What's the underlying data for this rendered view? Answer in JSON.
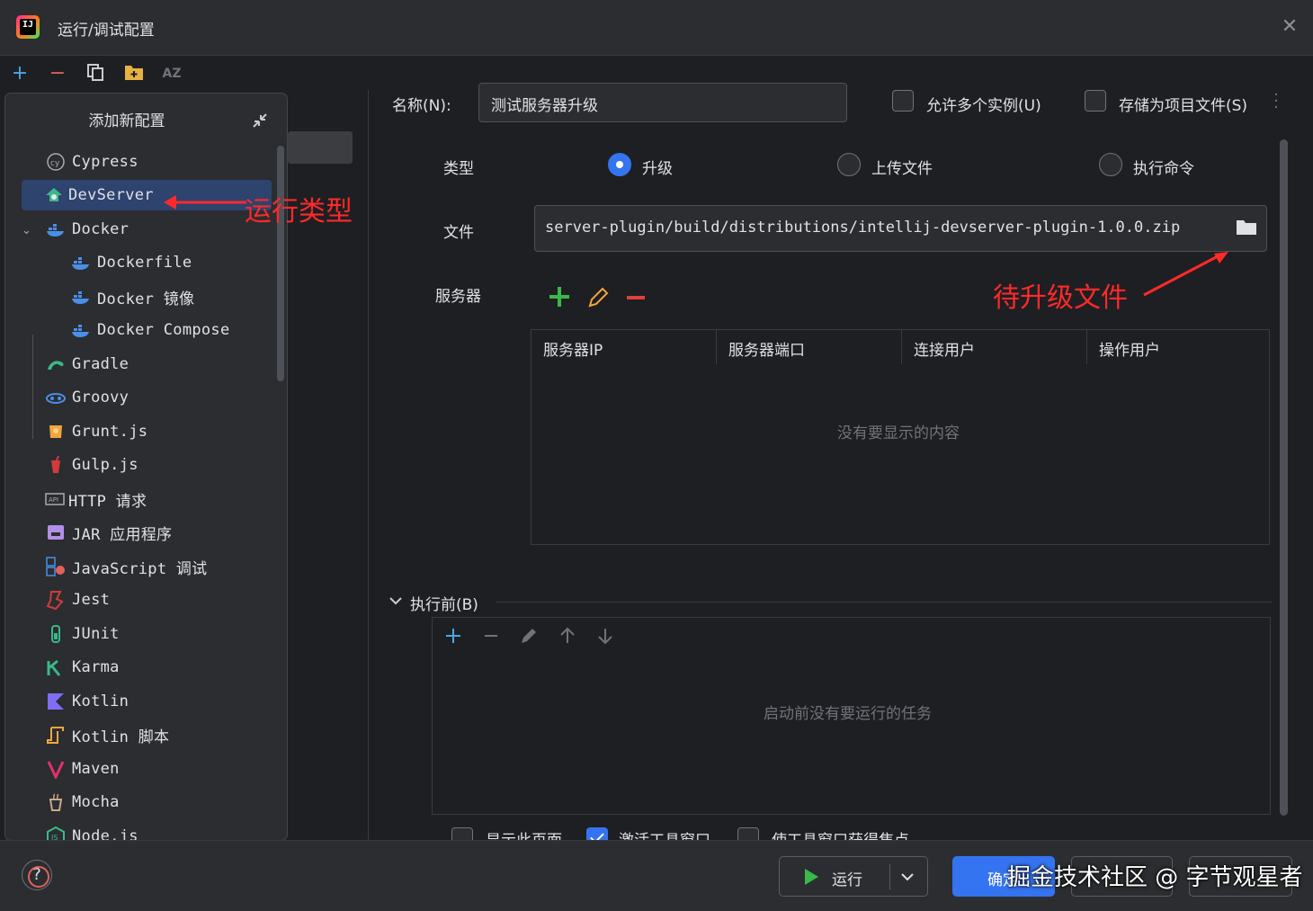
{
  "window": {
    "title": "运行/调试配置"
  },
  "toolbar": {
    "icons": [
      "add-icon",
      "remove-icon",
      "copy-icon",
      "new-folder-icon",
      "sort-az-icon"
    ],
    "sort_label": "AZ"
  },
  "popup": {
    "title": "添加新配置",
    "items": [
      {
        "label": "Cypress",
        "icon": "cypress-icon"
      },
      {
        "label": "DevServer",
        "icon": "devserver-icon",
        "selected": true
      },
      {
        "label": "Docker",
        "icon": "docker-icon",
        "expanded": true
      },
      {
        "label": "Dockerfile",
        "icon": "docker-icon",
        "child": true
      },
      {
        "label": "Docker 镜像",
        "icon": "docker-icon",
        "child": true
      },
      {
        "label": "Docker Compose",
        "icon": "docker-icon",
        "child": true
      },
      {
        "label": "Gradle",
        "icon": "gradle-icon"
      },
      {
        "label": "Groovy",
        "icon": "groovy-icon"
      },
      {
        "label": "Grunt.js",
        "icon": "grunt-icon"
      },
      {
        "label": "Gulp.js",
        "icon": "gulp-icon"
      },
      {
        "label": "HTTP 请求",
        "icon": "http-api-icon"
      },
      {
        "label": "JAR 应用程序",
        "icon": "jar-icon"
      },
      {
        "label": "JavaScript 调试",
        "icon": "js-debug-icon"
      },
      {
        "label": "Jest",
        "icon": "jest-icon"
      },
      {
        "label": "JUnit",
        "icon": "junit-icon"
      },
      {
        "label": "Karma",
        "icon": "karma-icon"
      },
      {
        "label": "Kotlin",
        "icon": "kotlin-icon"
      },
      {
        "label": "Kotlin 脚本",
        "icon": "kotlin-script-icon"
      },
      {
        "label": "Maven",
        "icon": "maven-icon"
      },
      {
        "label": "Mocha",
        "icon": "mocha-icon"
      },
      {
        "label": "Node.js",
        "icon": "nodejs-icon"
      }
    ]
  },
  "annotations": {
    "run_type": "运行类型",
    "upgrade_file": "待升级文件"
  },
  "form": {
    "name_label": "名称(N):",
    "name_value": "测试服务器升级",
    "allow_multiple": "允许多个实例(U)",
    "store_as_project": "存储为项目文件(S)",
    "type_label": "类型",
    "type_options": [
      "升级",
      "上传文件",
      "执行命令"
    ],
    "type_selected": 0,
    "file_label": "文件",
    "file_value": "server-plugin/build/distributions/intellij-devserver-plugin-1.0.0.zip",
    "server_label": "服务器",
    "table_headers": [
      "服务器IP",
      "服务器端口",
      "连接用户",
      "操作用户"
    ],
    "table_empty": "没有要显示的内容",
    "before_label": "执行前(B)",
    "before_empty": "启动前没有要运行的任务",
    "bottom_checks": [
      "显示此页面",
      "激活工具窗口",
      "使工具窗口获得焦点"
    ],
    "bottom_checks_state": [
      false,
      true,
      false
    ]
  },
  "footer": {
    "run_label": "运行",
    "ok_label": "确定",
    "watermark": "掘金技术社区 @ 字节观星者"
  },
  "colors": {
    "accent": "#3574f0",
    "annotation": "#ff2a2a",
    "selection": "#2e436e"
  }
}
